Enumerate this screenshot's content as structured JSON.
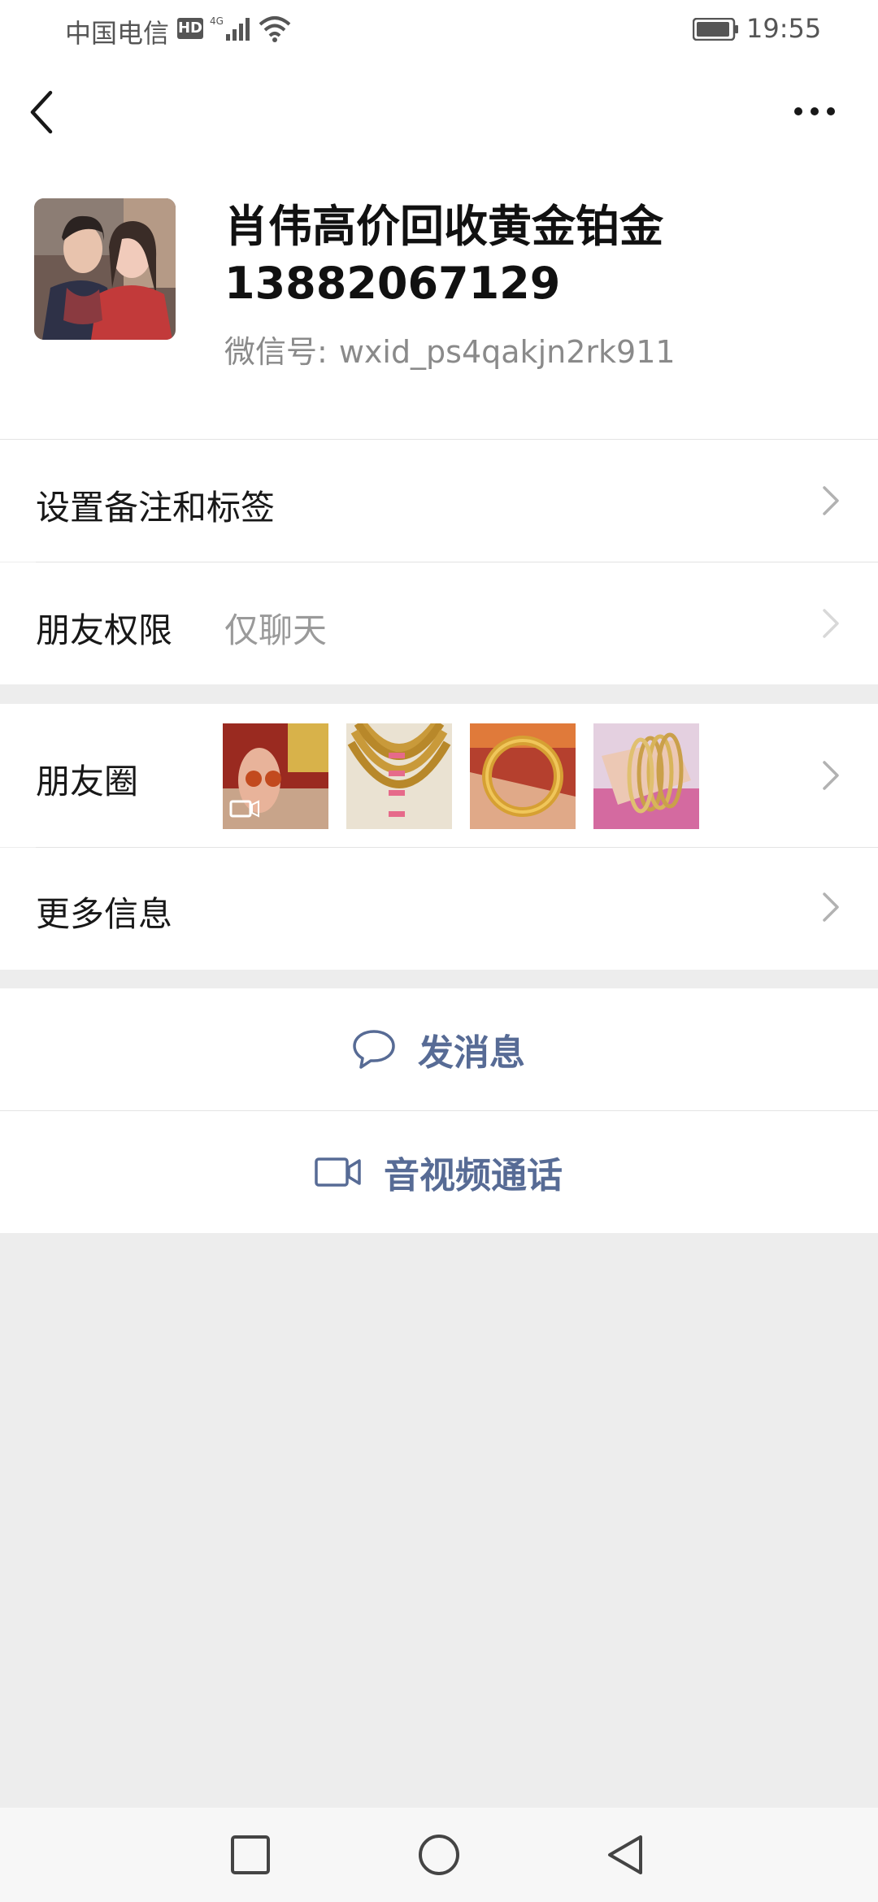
{
  "status_bar": {
    "carrier": "中国电信",
    "hd_badge": "HD",
    "network": "4G",
    "time": "19:55"
  },
  "nav": {
    "back_icon": "chevron-left-icon",
    "more_icon": "ellipsis-icon"
  },
  "profile": {
    "name_line1": "肖伟高价回收黄金铂金",
    "name_line2": "13882067129",
    "wxid_label": "微信号:",
    "wxid_value": "wxid_ps4qakjn2rk911"
  },
  "rows": {
    "remark": {
      "label": "设置备注和标签"
    },
    "permission": {
      "label": "朋友权限",
      "value": "仅聊天"
    },
    "moments": {
      "label": "朋友圈"
    },
    "more_info": {
      "label": "更多信息"
    }
  },
  "actions": {
    "message": {
      "label": "发消息",
      "icon": "chat-bubble-icon"
    },
    "call": {
      "label": "音视频通话",
      "icon": "video-camera-icon"
    }
  },
  "colors": {
    "link": "#576b95",
    "background": "#ededed"
  }
}
